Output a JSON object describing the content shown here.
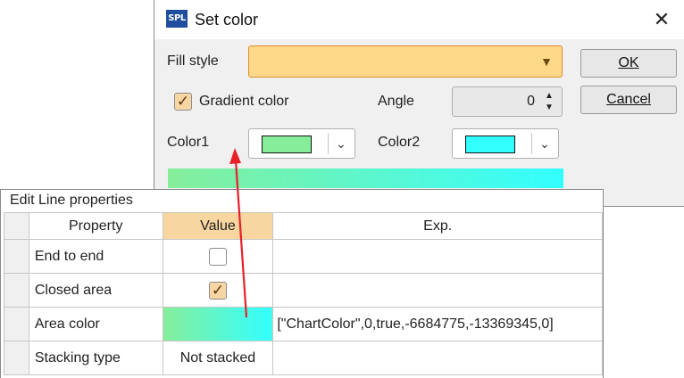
{
  "dialog": {
    "title": "Set color",
    "app_icon_text": "SPL",
    "close_glyph": "✕",
    "fill_style_label": "Fill style",
    "fill_style_value": "",
    "ok_button": "OK",
    "cancel_button": "Cancel",
    "gradient_checkbox_label": "Gradient color",
    "gradient_checked": true,
    "angle_label": "Angle",
    "angle_value": "0",
    "color1_label": "Color1",
    "color2_label": "Color2",
    "colors": {
      "fill_style_bg": "#ffd98a",
      "color1": "#86ee9a",
      "color2": "#33ffff"
    }
  },
  "panel": {
    "title": "Edit Line properties",
    "columns": [
      "Property",
      "Value",
      "Exp."
    ],
    "rows": [
      {
        "property": "End to end",
        "value_type": "checkbox",
        "checked": false,
        "exp": ""
      },
      {
        "property": "Closed area",
        "value_type": "checkbox",
        "checked": true,
        "exp": ""
      },
      {
        "property": "Area color",
        "value_type": "gradient",
        "exp": "[\"ChartColor\",0,true,-6684775,-13369345,0]"
      },
      {
        "property": "Stacking type",
        "value_type": "text",
        "value": "Not stacked",
        "exp": ""
      }
    ]
  },
  "annotation": {
    "arrow_color": "#e8202a"
  }
}
